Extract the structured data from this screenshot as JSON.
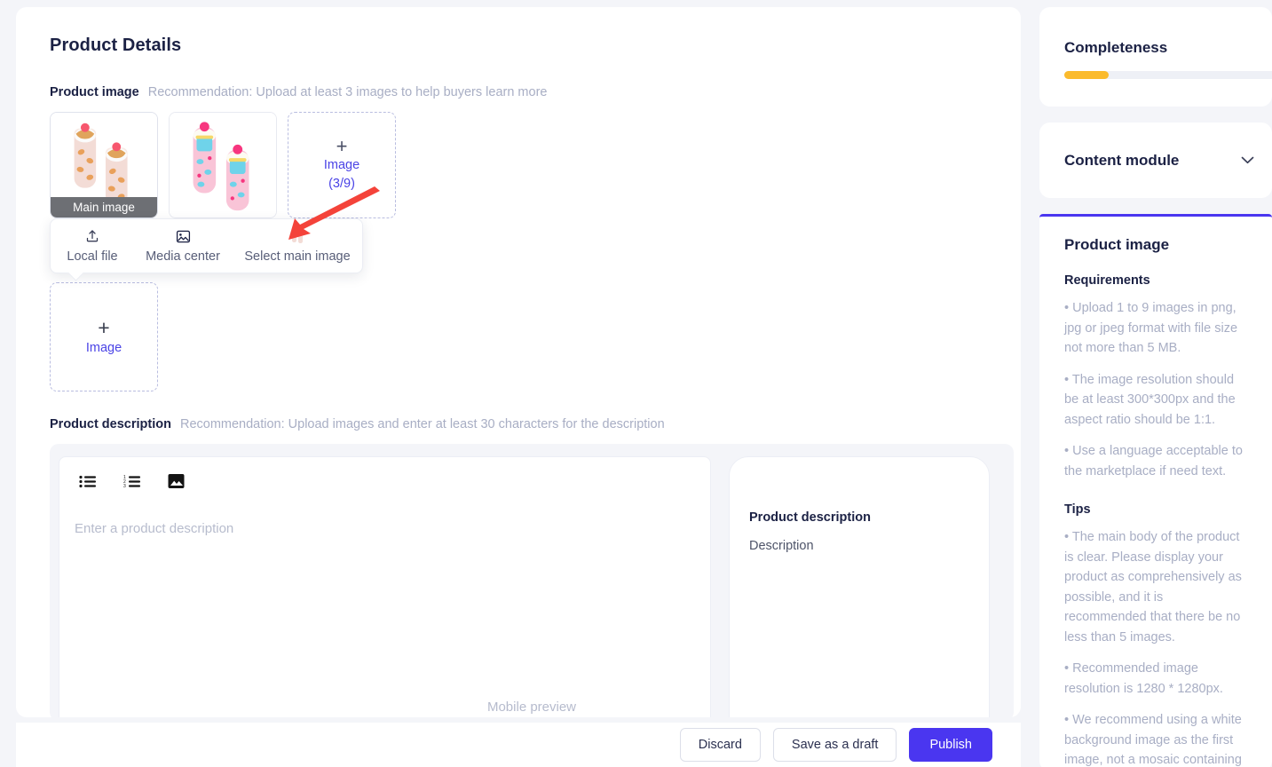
{
  "header": {
    "title": "Product Details"
  },
  "product_image": {
    "label": "Product image",
    "hint": "Recommendation: Upload at least 3 images to help buyers learn more",
    "main_badge": "Main image",
    "add_plus": "+",
    "add_caption": "Image",
    "add_count": "(3/9)",
    "big_add_plus": "+",
    "big_add_caption": "Image",
    "thumbnails": [
      {
        "name": "cupcake-socks-peach",
        "is_main": true
      },
      {
        "name": "cupcake-socks-pink",
        "is_main": false
      }
    ]
  },
  "upload_popover": {
    "items": [
      {
        "icon": "upload-icon",
        "label": "Local file"
      },
      {
        "icon": "media-center-icon",
        "label": "Media center"
      },
      {
        "icon": "select-main-image-thumbnail-icon",
        "label": "Select main image"
      }
    ]
  },
  "product_description": {
    "label": "Product description",
    "hint": "Recommendation: Upload images and enter at least 30 characters for the description",
    "toolbar": [
      {
        "icon": "bulleted-list-icon"
      },
      {
        "icon": "numbered-list-icon"
      },
      {
        "icon": "insert-image-icon"
      }
    ],
    "editor_placeholder": "Enter a product description",
    "preview": {
      "heading": "Product description",
      "body": "Description",
      "caption": "Mobile preview"
    }
  },
  "actions": {
    "discard": "Discard",
    "save_draft": "Save as a draft",
    "publish": "Publish"
  },
  "rail": {
    "completeness": {
      "title": "Completeness",
      "percent": 21
    },
    "content_module": {
      "title": "Content module",
      "chevron": "chevron-down-icon"
    },
    "guide": {
      "title": "Product image",
      "requirements_heading": "Requirements",
      "requirements": [
        "• Upload 1 to 9 images in png, jpg or jpeg format with file size not more than 5 MB.",
        "• The image resolution should be at least 300*300px and the aspect ratio should be 1:1.",
        "• Use a language acceptable to the marketplace if need text."
      ],
      "tips_heading": "Tips",
      "tips": [
        "• The main body of the product is clear. Please display your product as comprehensively as possible, and it is recommended that there be no less than 5 images.",
        "• Recommended image resolution is 1280 * 1280px.",
        "• We recommend using a white background image as the first image, not a mosaic containing"
      ]
    }
  },
  "colors": {
    "accent": "#4a36f0",
    "link": "#4a43e6",
    "progress": "#fbbb2d",
    "muted": "#a8aec4",
    "annotation_arrow": "#f4433a"
  }
}
